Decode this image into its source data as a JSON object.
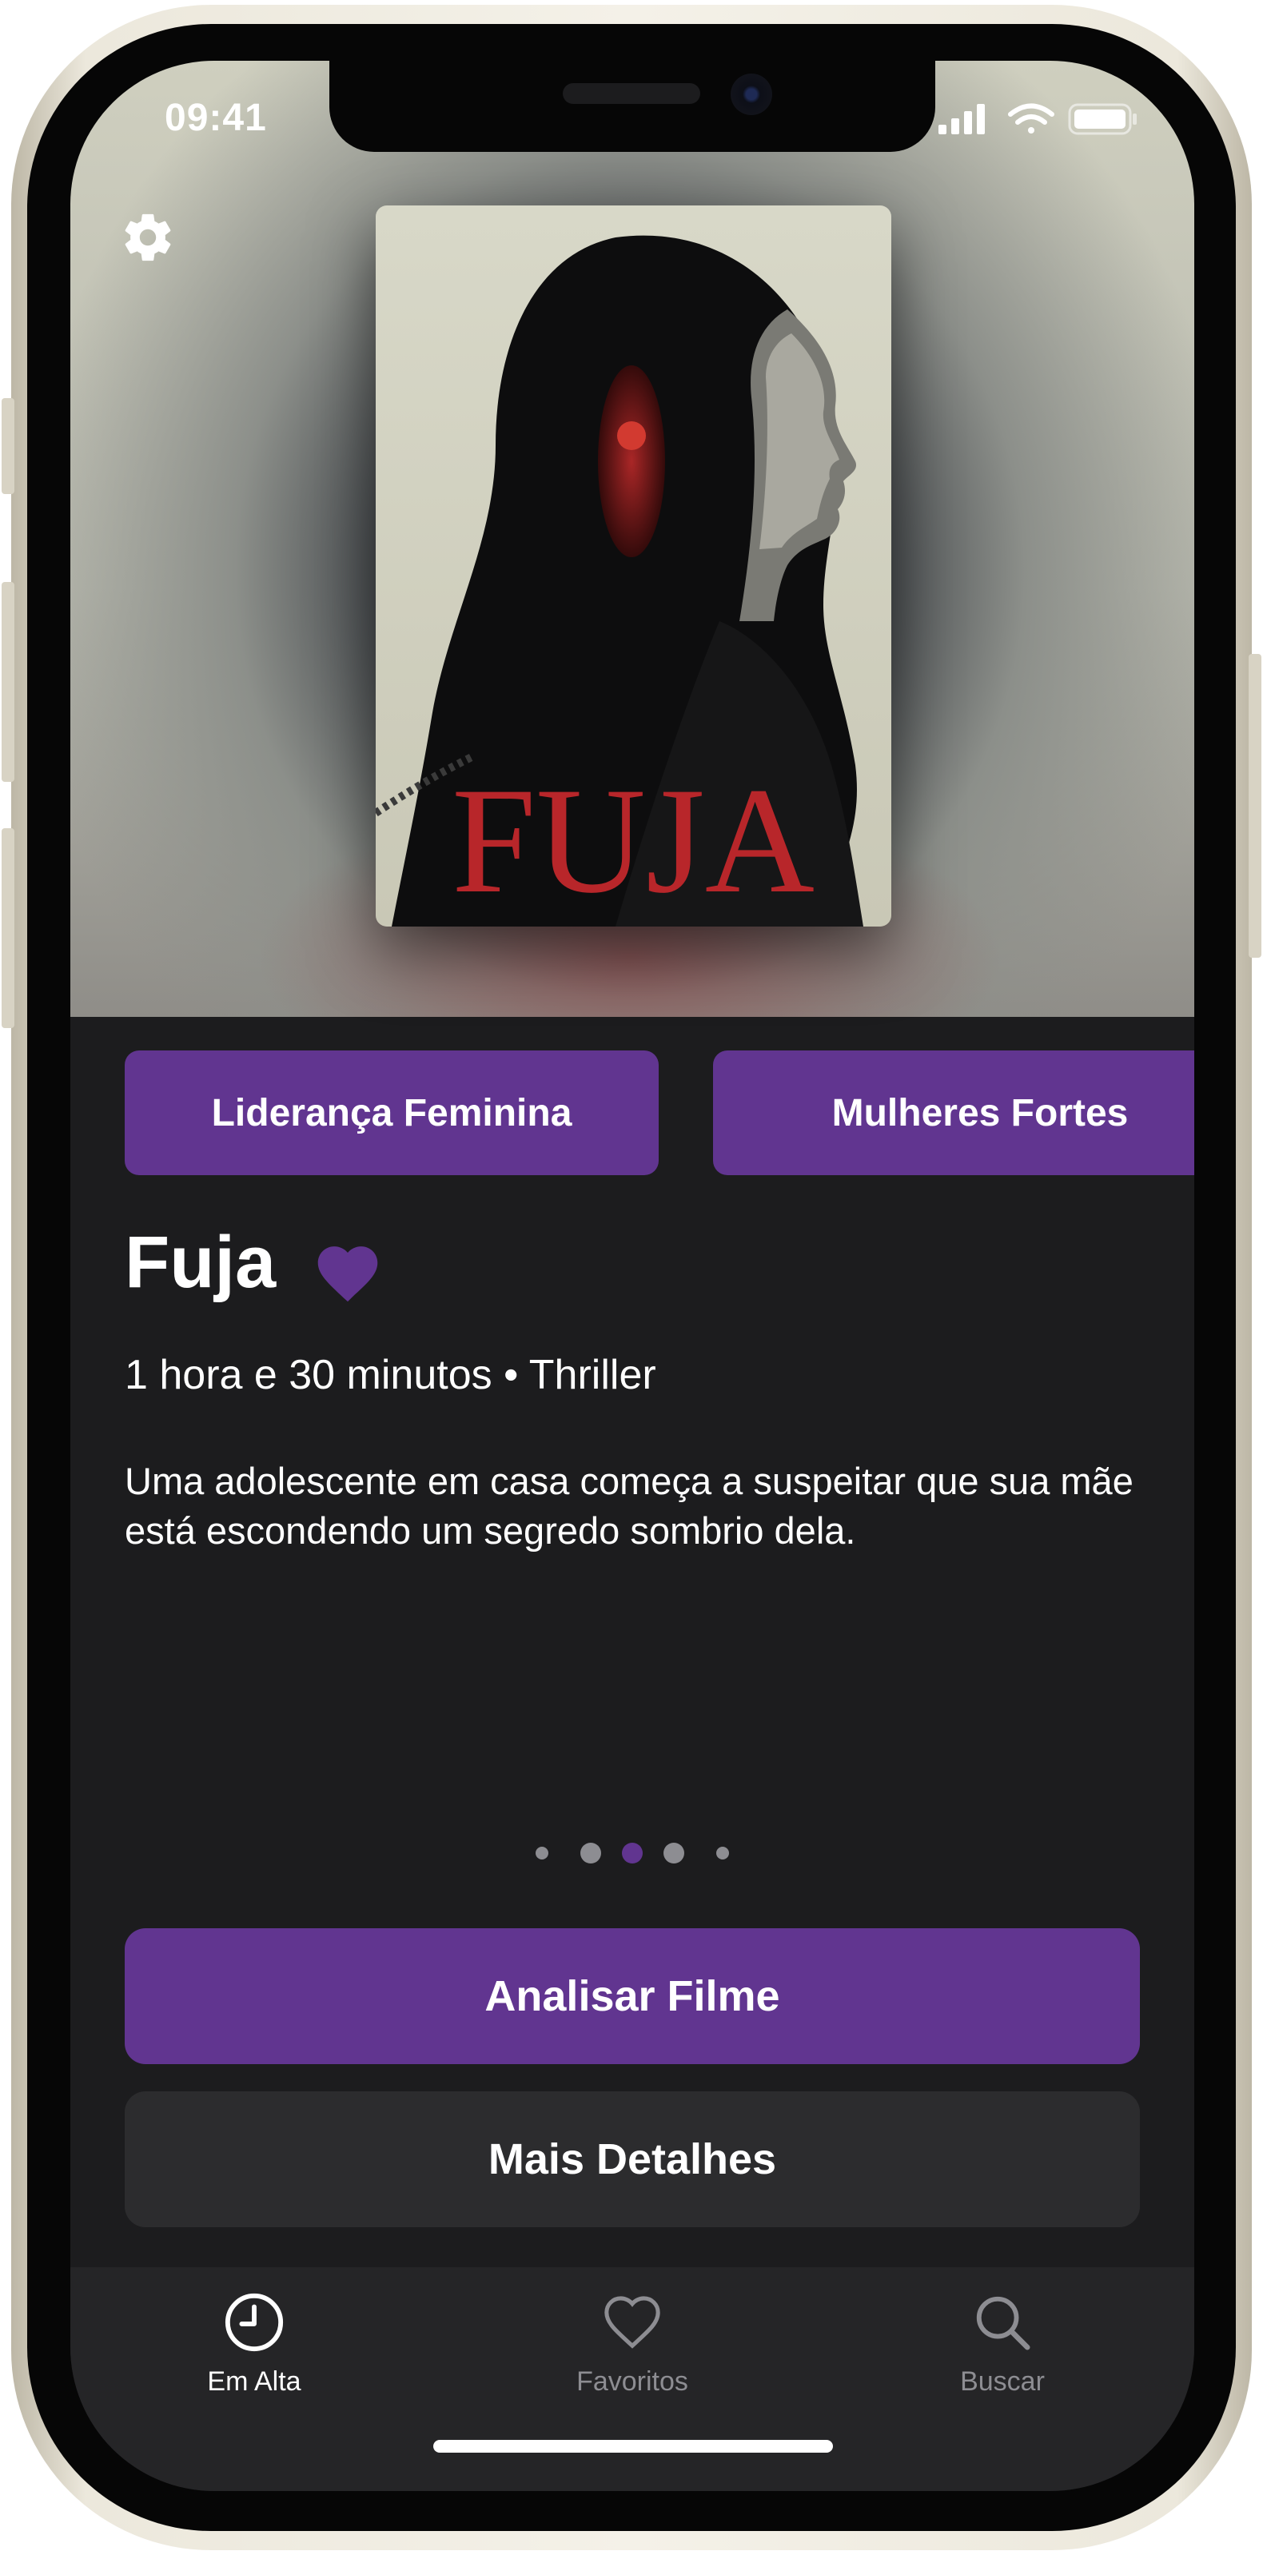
{
  "status_bar": {
    "time": "09:41"
  },
  "movie": {
    "title": "Fuja",
    "poster_title": "FUJA",
    "meta": "1 hora e 30 minutos • Thriller",
    "description": "Uma adolescente em casa começa a suspeitar que sua mãe está escondendo um segredo sombrio dela.",
    "favorite": true
  },
  "tags": [
    "Liderança Feminina",
    "Mulheres Fortes"
  ],
  "pager": {
    "count": 5,
    "current": 3
  },
  "actions": {
    "primary_label": "Analisar Filme",
    "secondary_label": "Mais Detalhes"
  },
  "tabs": [
    {
      "label": "Em Alta",
      "icon": "clock-icon",
      "active": true
    },
    {
      "label": "Favoritos",
      "icon": "heart-outline-icon",
      "active": false
    },
    {
      "label": "Buscar",
      "icon": "magnifier-icon",
      "active": false
    }
  ],
  "colors": {
    "accent": "#613590",
    "background": "#1c1c1e",
    "secondary_button": "#2c2c2e",
    "tab_inactive": "#8d8d92",
    "poster_title_red": "#b8262a"
  }
}
